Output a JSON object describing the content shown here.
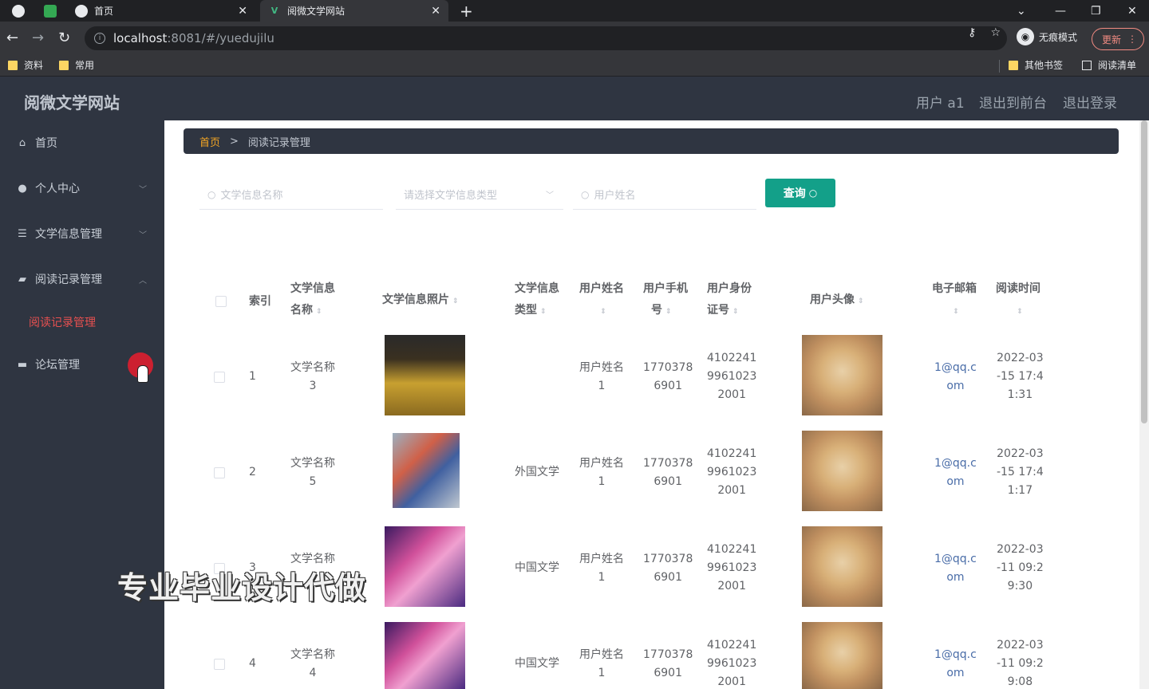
{
  "browser": {
    "tabs": [
      {
        "label": "首页"
      },
      {
        "label": "阅微文学网站"
      }
    ],
    "url_host": "localhost",
    "url_path": ":8081/#/yuedujilu",
    "incognito_label": "无痕模式",
    "update_label": "更新",
    "bookmarks": [
      "资料",
      "常用"
    ],
    "bookmarks_right": [
      "其他书签",
      "阅读清单"
    ]
  },
  "app": {
    "title": "阅微文学网站",
    "user_label": "用户 a1",
    "back_to_front": "退出到前台",
    "logout": "退出登录"
  },
  "sidebar": {
    "items": [
      {
        "label": "首页",
        "icon": "home-icon"
      },
      {
        "label": "个人中心",
        "icon": "user-icon"
      },
      {
        "label": "文学信息管理",
        "icon": "list-icon"
      },
      {
        "label": "阅读记录管理",
        "icon": "reading-icon"
      },
      {
        "label": "论坛管理",
        "icon": "forum-icon"
      }
    ],
    "sub_active": "阅读记录管理"
  },
  "breadcrumb": {
    "home": "首页",
    "current": "阅读记录管理"
  },
  "search": {
    "name_placeholder": "文学信息名称",
    "type_placeholder": "请选择文学信息类型",
    "user_placeholder": "用户姓名",
    "query_label": "查询"
  },
  "table": {
    "headers": {
      "index": "索引",
      "name_a": "文学信息",
      "name_b": "名称",
      "photo": "文学信息照片",
      "type_a": "文学信息",
      "type_b": "类型",
      "uname_a": "用户姓名",
      "phone_a": "用户手机",
      "phone_b": "号",
      "idno_a": "用户身份",
      "idno_b": "证号",
      "avatar": "用户头像",
      "email_a": "电子邮箱",
      "time_a": "阅读时间"
    },
    "rows": [
      {
        "index": "1",
        "name_a": "文学名称",
        "name_b": "3",
        "type": "",
        "uname_a": "用户姓名",
        "uname_b": "1",
        "phone_a": "1770378",
        "phone_b": "6901",
        "id_a": "4102241",
        "id_b": "9961023",
        "id_c": "2001",
        "email_a": "1@qq.c",
        "email_b": "om",
        "time_a": "2022-03",
        "time_b": "-15 17:4",
        "time_c": "1:31"
      },
      {
        "index": "2",
        "name_a": "文学名称",
        "name_b": "5",
        "type": "外国文学",
        "uname_a": "用户姓名",
        "uname_b": "1",
        "phone_a": "1770378",
        "phone_b": "6901",
        "id_a": "4102241",
        "id_b": "9961023",
        "id_c": "2001",
        "email_a": "1@qq.c",
        "email_b": "om",
        "time_a": "2022-03",
        "time_b": "-15 17:4",
        "time_c": "1:17"
      },
      {
        "index": "3",
        "name_a": "文学名称",
        "name_b": "",
        "type": "中国文学",
        "uname_a": "用户姓名",
        "uname_b": "1",
        "phone_a": "1770378",
        "phone_b": "6901",
        "id_a": "4102241",
        "id_b": "9961023",
        "id_c": "2001",
        "email_a": "1@qq.c",
        "email_b": "om",
        "time_a": "2022-03",
        "time_b": "-11 09:2",
        "time_c": "9:30"
      },
      {
        "index": "4",
        "name_a": "文学名称",
        "name_b": "4",
        "type": "中国文学",
        "uname_a": "用户姓名",
        "uname_b": "1",
        "phone_a": "1770378",
        "phone_b": "6901",
        "id_a": "4102241",
        "id_b": "9961023",
        "id_c": "2001",
        "email_a": "1@qq.c",
        "email_b": "om",
        "time_a": "2022-03",
        "time_b": "-11 09:2",
        "time_c": "9:08"
      }
    ]
  },
  "watermark": "专业毕业设计代做"
}
